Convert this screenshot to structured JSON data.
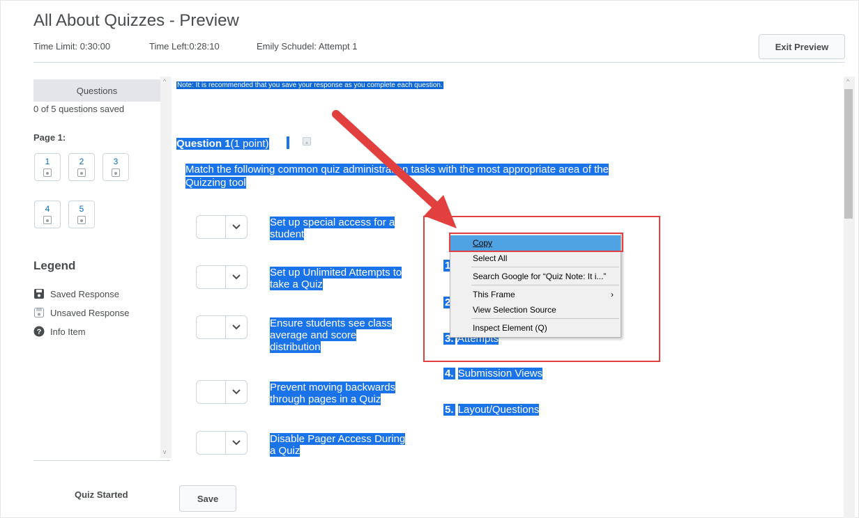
{
  "header": {
    "title": "All About Quizzes - Preview",
    "time_limit": "Time Limit: 0:30:00",
    "time_left": "Time Left:0:28:10",
    "attempt": "Emily Schudel: Attempt 1",
    "exit_button": "Exit Preview"
  },
  "sidebar": {
    "heading": "Questions",
    "saved_count": "0 of 5 questions saved",
    "page_label": "Page 1:",
    "question_numbers": [
      "1",
      "2",
      "3",
      "4",
      "5"
    ],
    "legend_title": "Legend",
    "legend": {
      "saved": "Saved Response",
      "unsaved": "Unsaved Response",
      "info": "Info Item"
    },
    "quiz_started": "Quiz Started"
  },
  "main": {
    "note": "Note: It is recommended that you save your response as you complete each question.",
    "question_title": "Question 1",
    "question_points": "(1 point)",
    "question_text_line1": "Match the following common quiz administration tasks with the most appropriate area of the",
    "question_text_line2": "Quizzing tool",
    "items": [
      {
        "line1": "Set up special access for a",
        "line2": "student",
        "line3": ""
      },
      {
        "line1": "Set up Unlimited Attempts to",
        "line2": "take a Quiz",
        "line3": ""
      },
      {
        "line1": "Ensure students see class",
        "line2": "average and score",
        "line3": "distribution"
      },
      {
        "line1": "Prevent moving backwards",
        "line2": "through pages in a Quiz",
        "line3": ""
      },
      {
        "line1": "Disable Pager Access During",
        "line2": "a Quiz",
        "line3": ""
      }
    ],
    "options": [
      {
        "num": "1",
        "label": ""
      },
      {
        "num": "2",
        "label": ""
      },
      {
        "num": "3.",
        "label": "Attempts"
      },
      {
        "num": "4.",
        "label": "Submission Views"
      },
      {
        "num": "5.",
        "label": "Layout/Questions"
      }
    ],
    "save_button": "Save"
  },
  "context_menu": {
    "copy": "Copy",
    "select_all": "Select All",
    "search_google": "Search Google for “Quiz Note: It i...”",
    "this_frame": "This Frame",
    "view_selection_source": "View Selection Source",
    "inspect_element": "Inspect Element (Q)"
  },
  "colors": {
    "selection": "#1a73e8",
    "annotation_red": "#e2403f",
    "menu_highlight": "#4fa3e3",
    "link_blue": "#006fbf"
  }
}
